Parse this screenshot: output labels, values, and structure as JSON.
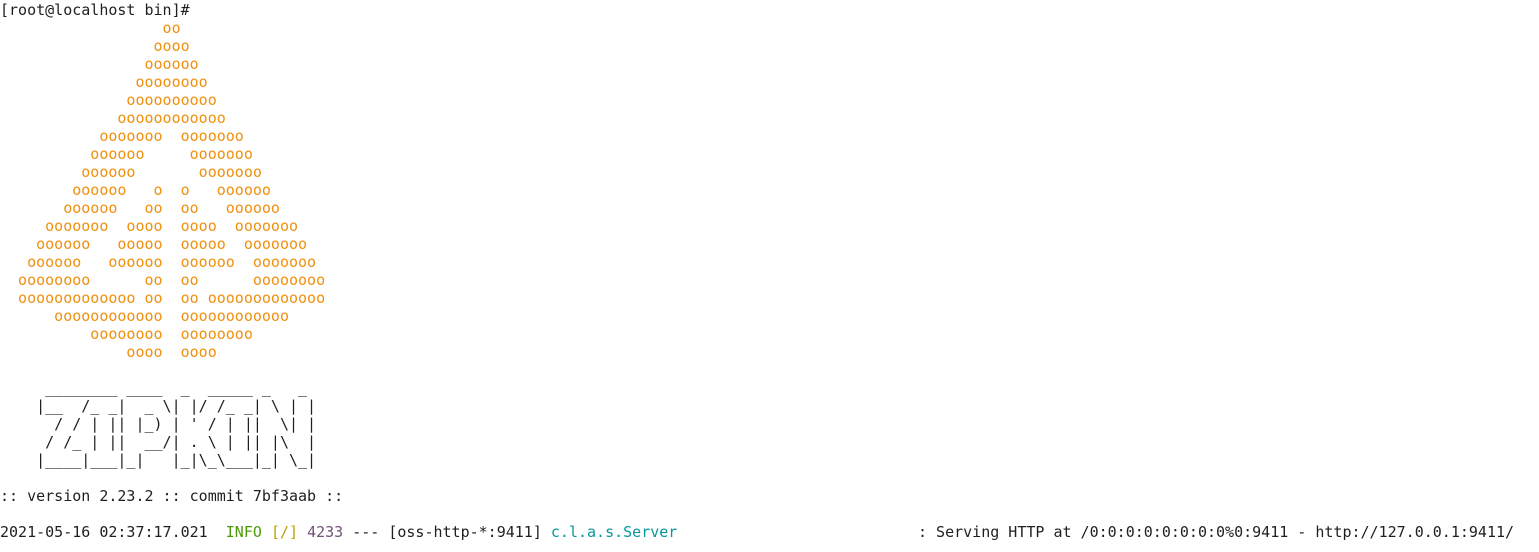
{
  "terminal": {
    "prompt": "[root@localhost bin]#",
    "logo_color": "#f0900f",
    "art_lines": [
      "                  oo",
      "                 oooo",
      "                oooooo",
      "               oooooooo",
      "              oooooooooo",
      "             oooooooooooo",
      "           ooooooo  ooooooo",
      "          oooooo     ooooooo",
      "         oooooo       ooooooo",
      "        oooooo   o  o   oooooo",
      "       oooooo   oo  oo   oooooo",
      "     ooooooo  oooo  oooo  ooooooo",
      "    oooooo   ooooo  ooooo  ooooooo",
      "   oooooo   oooooo  oooooo  ooooooo",
      "  oooooooo      oo  oo      oooooooo",
      "  ooooooooooooo oo  oo ooooooooooooo",
      "      oooooooooooo  oooooooooooo",
      "          oooooooo  oooooooo",
      "              oooo  oooo"
    ],
    "banner_lines": [
      "     ________ ____  _  _____ _   _",
      "    |__  /_ _|  _ \\| |/ /_ _| \\ | |",
      "      / / | || |_) | ' / | ||  \\| |",
      "     / /_ | ||  __/| . \\ | || |\\  |",
      "    |____|___|_|   |_|\\_\\___|_| \\_|"
    ],
    "version_line": ":: version 2.23.2 :: commit 7bf3aab ::",
    "log": {
      "timestamp": "2021-05-16 02:37:17.021",
      "level": "INFO",
      "thread_tag": "[/]",
      "pid": "4233",
      "separator": "---",
      "thread": "[oss-http-*:9411]",
      "logger": "c.l.a.s.Server",
      "message": ": Serving HTTP at /0:0:0:0:0:0:0:0%0:9411 - http://127.0.0.1:9411/"
    }
  }
}
